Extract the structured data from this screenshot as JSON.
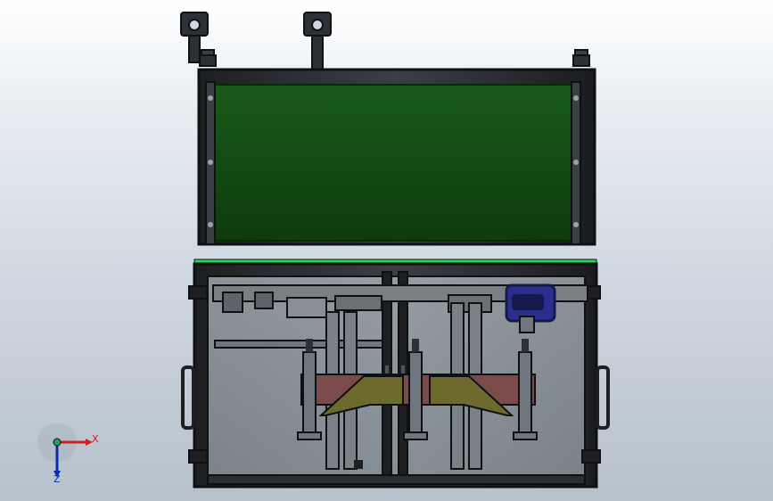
{
  "viewport": {
    "background_top": "#ffffff",
    "background_bottom": "#b7c1cb"
  },
  "model": {
    "frame_color": "#2a2d31",
    "frame_edge_color": "#0f1012",
    "panel_color": "#0f3f10",
    "panel_edge_color": "#082808",
    "highlight_color": "#2bd35a",
    "accent_blue": "#2a2f8f",
    "accent_blue_dark": "#151a4b",
    "accent_olive": "#6c6a2d",
    "accent_red": "#7b4a4a",
    "accent_gray": "#8a9096",
    "mechanism_gray": "#6f767d"
  },
  "triad": {
    "x_label": "X",
    "z_label": "Z",
    "x_color": "#d21f1f",
    "z_color": "#0b2bb3",
    "origin_color": "#1fa35a"
  }
}
